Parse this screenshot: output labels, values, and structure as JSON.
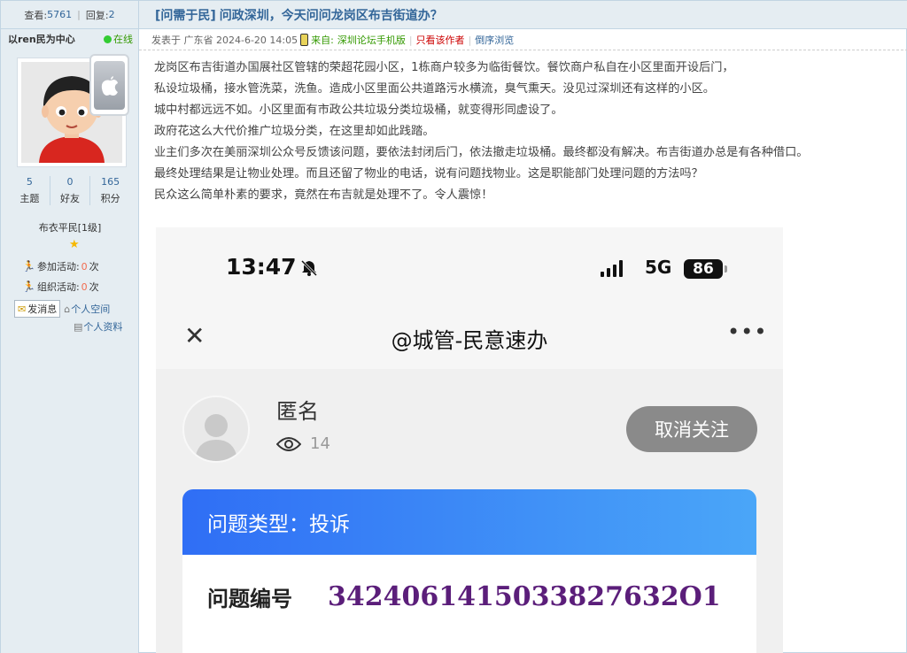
{
  "thread": {
    "views_label": "查看:",
    "views": "5761",
    "replies_label": "回复:",
    "replies": "2",
    "category": "[问需于民]",
    "title": "问政深圳，今天问问龙岗区布吉街道办？"
  },
  "author": {
    "name": "以ren民为中心",
    "online_label": "在线",
    "stats": [
      {
        "value": "5",
        "label": "主题"
      },
      {
        "value": "0",
        "label": "好友"
      },
      {
        "value": "165",
        "label": "积分"
      }
    ],
    "rank": "布衣平民[1级]",
    "activities": [
      {
        "label": "参加活动:",
        "count": "0",
        "unit": "次"
      },
      {
        "label": "组织活动:",
        "count": "0",
        "unit": "次"
      }
    ],
    "send_message": "发消息",
    "personal_space": "个人空间",
    "personal_profile": "个人资料"
  },
  "meta": {
    "posted_prefix": "发表于",
    "location": "广东省",
    "date": "2024-6-20 14:05",
    "from_label": "来自:",
    "source": "深圳论坛手机版",
    "only_author": "只看该作者",
    "reverse": "倒序浏览"
  },
  "post_lines": [
    "龙岗区布吉街道办国展社区管辖的荣超花园小区，1栋商户较多为临街餐饮。餐饮商户私自在小区里面开设后门，",
    "私设垃圾桶，接水管洗菜，洗鱼。造成小区里面公共道路污水横流，臭气熏天。没见过深圳还有这样的小区。",
    "城中村都远远不如。小区里面有市政公共垃圾分类垃圾桶，就变得形同虚设了。",
    "政府花这么大代价推广垃圾分类，在这里却如此践踏。",
    "业主们多次在美丽深圳公众号反馈该问题，要依法封闭后门，依法撤走垃圾桶。最终都没有解决。布吉街道办总是有各种借口。",
    "最终处理结果是让物业处理。而且还留了物业的电话，说有问题找物业。这是职能部门处理问题的方法吗？",
    "民众这么简单朴素的要求，竟然在布吉就是处理不了。令人震惊！"
  ],
  "screenshot": {
    "time": "13:47",
    "network": "5G",
    "battery": "86",
    "nav_title": "@城管-民意速办",
    "user_name": "匿名",
    "views": "14",
    "follow_button": "取消关注",
    "issue_type_label": "问题类型：投诉",
    "issue_no_label": "问题编号",
    "issue_no": "3424061415033827632O1"
  },
  "colors": {
    "accent": "#336699",
    "border": "#c2d5e3",
    "panel": "#e5edf2",
    "card_gradient_start": "#2f6ef5",
    "card_gradient_end": "#4aa6f8",
    "issue_number": "#5b1e7a"
  }
}
